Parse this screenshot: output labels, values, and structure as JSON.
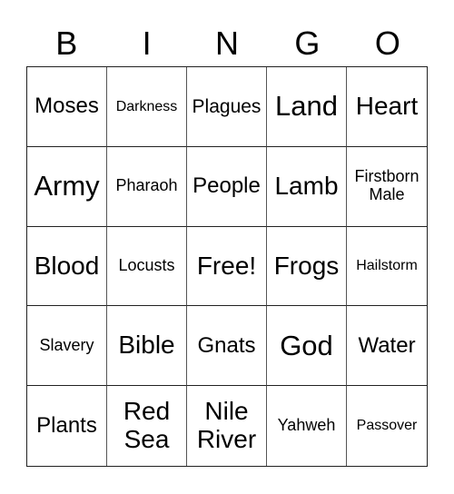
{
  "header": [
    "B",
    "I",
    "N",
    "G",
    "O"
  ],
  "cells": [
    "Moses",
    "Darkness",
    "Plagues",
    "Land",
    "Heart",
    "Army",
    "Pharaoh",
    "People",
    "Lamb",
    "Firstborn Male",
    "Blood",
    "Locusts",
    "Free!",
    "Frogs",
    "Hailstorm",
    "Slavery",
    "Bible",
    "Gnats",
    "God",
    "Water",
    "Plants",
    "Red Sea",
    "Nile River",
    "Yahweh",
    "Passover"
  ]
}
